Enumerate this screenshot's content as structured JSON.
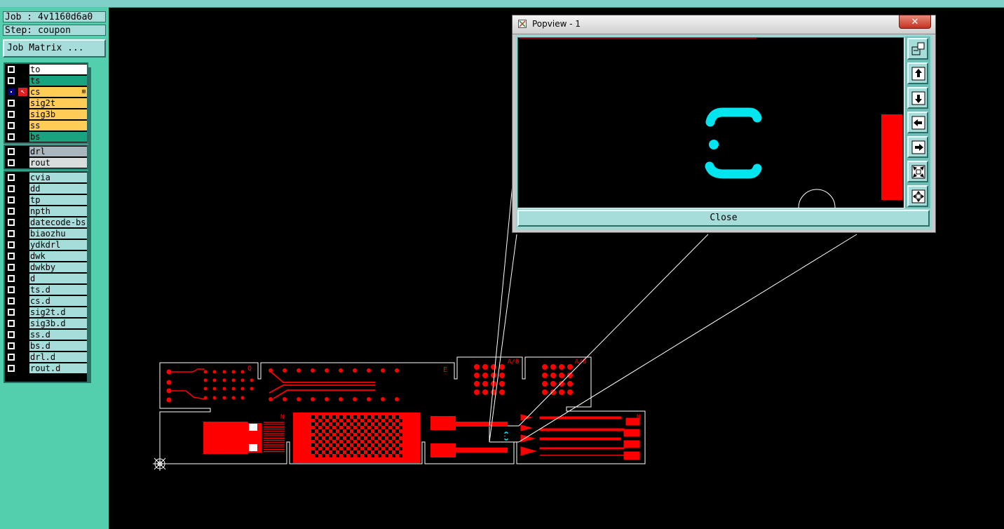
{
  "job": {
    "job_label": "Job : 4v1160d6a0",
    "step_label": "Step: coupon",
    "matrix_button": "Job Matrix ..."
  },
  "layers": {
    "signal": [
      {
        "name": "to",
        "color": "#ffffff"
      },
      {
        "name": "ts",
        "color": "#1aa37f"
      },
      {
        "name": "cs",
        "color": "#ffcc55",
        "active": true
      },
      {
        "name": "sig2t",
        "color": "#ffcc55"
      },
      {
        "name": "sig3b",
        "color": "#ffcc55"
      },
      {
        "name": "ss",
        "color": "#ffcc55"
      },
      {
        "name": "bs",
        "color": "#1aa37f"
      }
    ],
    "drill": [
      {
        "name": "drl",
        "color": "#a9b6bd"
      },
      {
        "name": "rout",
        "color": "#d9dcdc"
      }
    ],
    "misc": [
      {
        "name": "cvia"
      },
      {
        "name": "dd"
      },
      {
        "name": "tp"
      },
      {
        "name": "npth"
      },
      {
        "name": "datecode-bs"
      },
      {
        "name": "biaozhu"
      },
      {
        "name": "ydkdrl"
      },
      {
        "name": "dwk"
      },
      {
        "name": "dwkby"
      },
      {
        "name": "d"
      },
      {
        "name": "ts.d"
      },
      {
        "name": "cs.d"
      },
      {
        "name": "sig2t.d"
      },
      {
        "name": "sig3b.d"
      },
      {
        "name": "ss.d"
      },
      {
        "name": "bs.d"
      },
      {
        "name": "drl.d"
      },
      {
        "name": "rout.d"
      }
    ],
    "misc_color": "#a6dcd9"
  },
  "popview": {
    "title": "Popview - 1",
    "close_glyph": "✕",
    "close_button": "Close",
    "tools": [
      "zoom-window-icon",
      "pan-up-icon",
      "pan-down-icon",
      "pan-left-icon",
      "pan-right-icon",
      "zoom-out-icon",
      "zoom-fit-icon"
    ]
  },
  "board": {
    "labels": {
      "q": "Q",
      "e": "E",
      "ab1": "A/B",
      "ab2": "A/B",
      "n1": "N",
      "n2": "N"
    }
  },
  "colors": {
    "copper": "#ff0000",
    "outline": "#ffffff",
    "highlight": "#00e5ee"
  }
}
